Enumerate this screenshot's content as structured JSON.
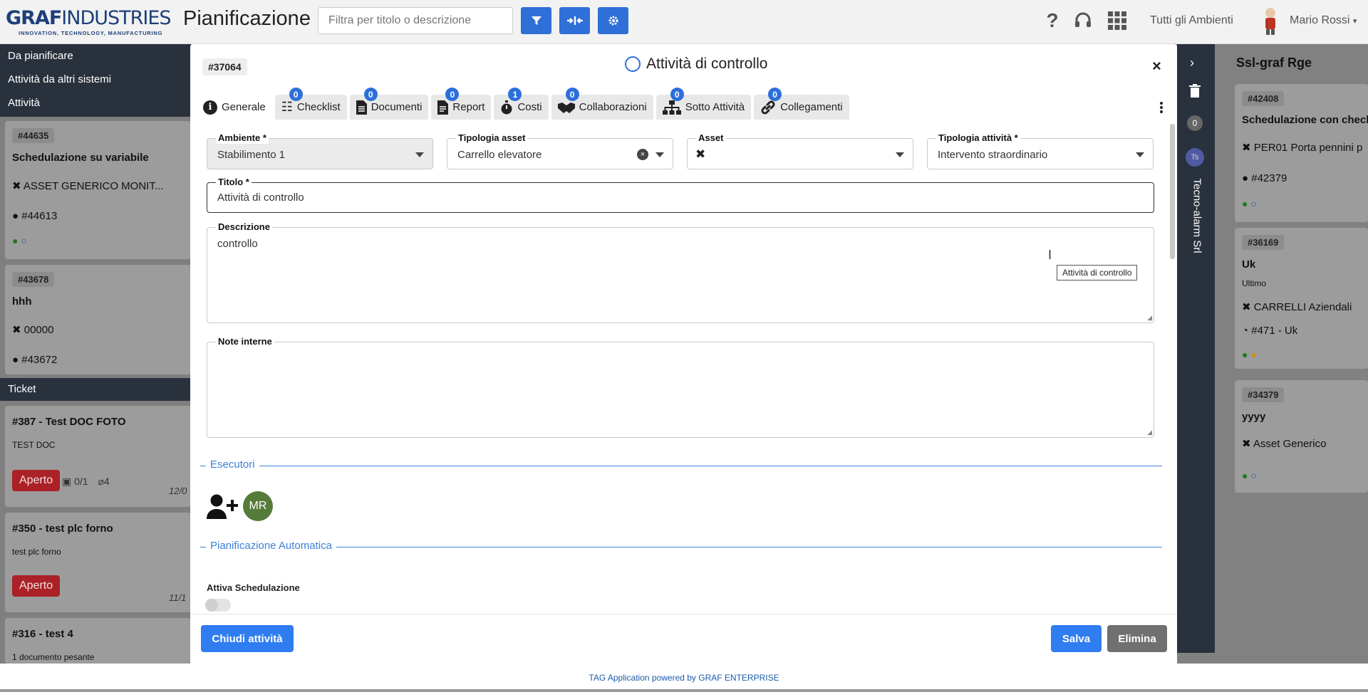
{
  "header": {
    "logo_main": "GRAF",
    "logo_thin": "INDUSTRIES",
    "logo_tagline": "INNOVATION, TECHNOLOGY, MANUFACTURING",
    "app_title": "Pianificazione",
    "filter_placeholder": "Filtra per titolo o descrizione",
    "environments": "Tutti gli Ambienti",
    "user_name": "Mario Rossi"
  },
  "left": {
    "nav": [
      "Da pianificare",
      "Attività da altri sistemi",
      "Attività"
    ],
    "cards": [
      {
        "id": "#44635",
        "title": "Schedulazione su variabile",
        "asset": "ASSET GENERICO MONIT...",
        "ref": "#44613"
      },
      {
        "id": "#43678",
        "title": "hhh",
        "asset": "00000",
        "ref": "#43672"
      }
    ],
    "ticket_header": "Ticket",
    "tickets": [
      {
        "title": "#387 - Test DOC FOTO",
        "desc": "TEST DOC",
        "status": "Aperto",
        "checks": "0/1",
        "attachments": "4",
        "date": "12/0"
      },
      {
        "title": "#350 - test plc forno",
        "desc": "test plc forno",
        "status": "Aperto",
        "date": "11/1"
      },
      {
        "title": "#316 - test 4",
        "desc": "1 documento pesante"
      }
    ]
  },
  "right": {
    "vertical_label": "Tecno-alarm Srl",
    "counter": "0",
    "initials": "Ts",
    "title": "Ssl-graf Rge",
    "cards": [
      {
        "id": "#42408",
        "title": "Schedulazione con check",
        "asset": "PER01 Porta pennini p",
        "ref": "#42379"
      },
      {
        "id": "#36169",
        "title": "Uk",
        "sub": "Ultimo",
        "asset": "CARRELLI Aziendali",
        "ref": "#471 - Uk"
      },
      {
        "id": "#34379",
        "title": "yyyy",
        "asset": "Asset Generico"
      }
    ]
  },
  "modal": {
    "id": "#37064",
    "title": "Attività di controllo",
    "tabs": [
      {
        "label": "Generale",
        "icon": "info-icon"
      },
      {
        "label": "Checklist",
        "count": "0",
        "icon": "checklist-icon"
      },
      {
        "label": "Documenti",
        "count": "0",
        "icon": "document-icon"
      },
      {
        "label": "Report",
        "count": "0",
        "icon": "report-icon"
      },
      {
        "label": "Costi",
        "count": "1",
        "icon": "stopwatch-icon"
      },
      {
        "label": "Collaborazioni",
        "count": "0",
        "icon": "handshake-icon"
      },
      {
        "label": "Sotto Attività",
        "count": "0",
        "icon": "sitemap-icon"
      },
      {
        "label": "Collegamenti",
        "count": "0",
        "icon": "link-icon"
      }
    ],
    "fields": {
      "ambiente_label": "Ambiente *",
      "ambiente_value": "Stabilimento 1",
      "tipologia_asset_label": "Tipologia asset",
      "tipologia_asset_value": "Carrello elevatore",
      "asset_label": "Asset",
      "tipologia_attivita_label": "Tipologia attività *",
      "tipologia_attivita_value": "Intervento straordinario",
      "titolo_label": "Titolo *",
      "titolo_value": "Attività di controllo",
      "descrizione_label": "Descrizione",
      "descrizione_value": "controllo",
      "note_label": "Note interne",
      "note_value": ""
    },
    "tooltip": "Attività di controllo",
    "section_esecutori": "Esecutori",
    "executor_initials": "MR",
    "section_pianificazione": "Pianificazione Automatica",
    "schedulazione_label": "Attiva Schedulazione",
    "buttons": {
      "close_activity": "Chiudi attività",
      "save": "Salva",
      "delete": "Elimina"
    }
  },
  "footer": "TAG Application powered by GRAF ENTERPRISE",
  "colors": {
    "primary": "#2f6fd8",
    "dark_nav": "#29313d",
    "danger": "#aa2227",
    "section": "#3d7fd8",
    "avatar_green": "#557b3a"
  }
}
